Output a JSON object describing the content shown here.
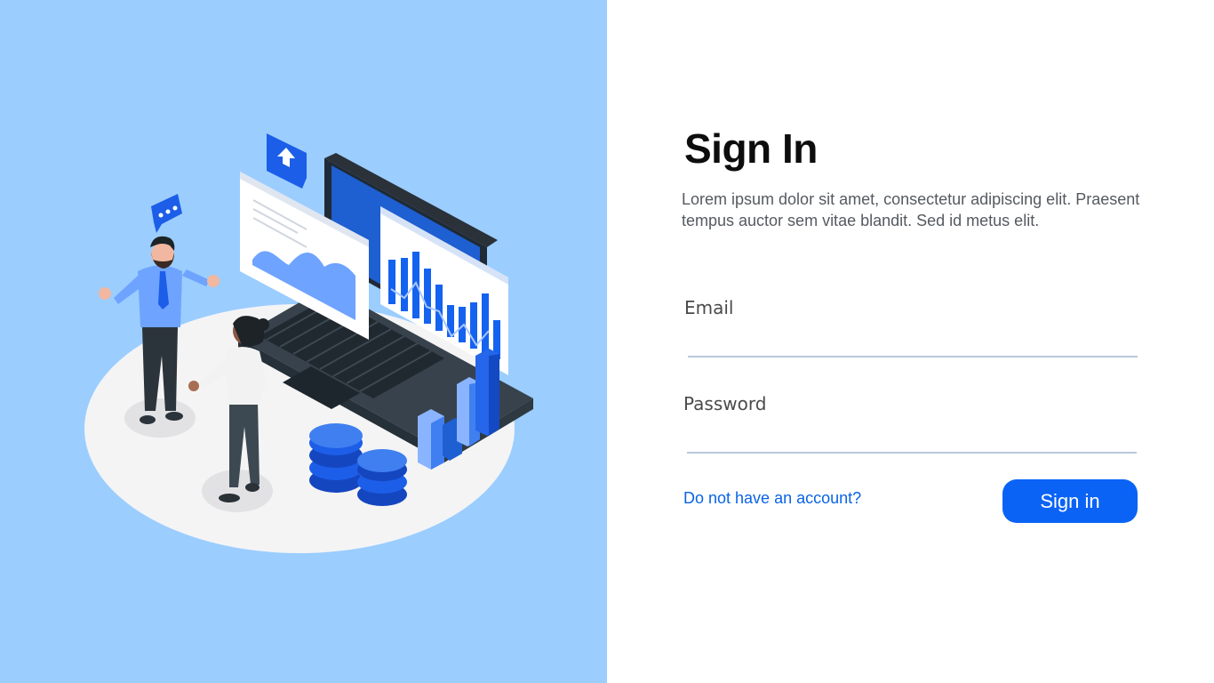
{
  "signin": {
    "title": "Sign In",
    "description": "Lorem ipsum dolor sit amet, consectetur adipiscing elit. Praesent tempus auctor sem vitae blandit. Sed id metus elit.",
    "email_label": "Email",
    "email_value": "",
    "password_label": "Password",
    "password_value": "",
    "signup_link": "Do not have an account?",
    "submit_label": "Sign in"
  },
  "illustration": {
    "icons": [
      "chat-bubble-icon",
      "upload-arrow-icon",
      "laptop-icon",
      "coin-stack-icon",
      "bar-chart-icon"
    ]
  },
  "colors": {
    "left_background": "#9bcdff",
    "accent": "#0a63f5",
    "link": "#0a63e6",
    "input_underline": "#b8c8dc"
  }
}
